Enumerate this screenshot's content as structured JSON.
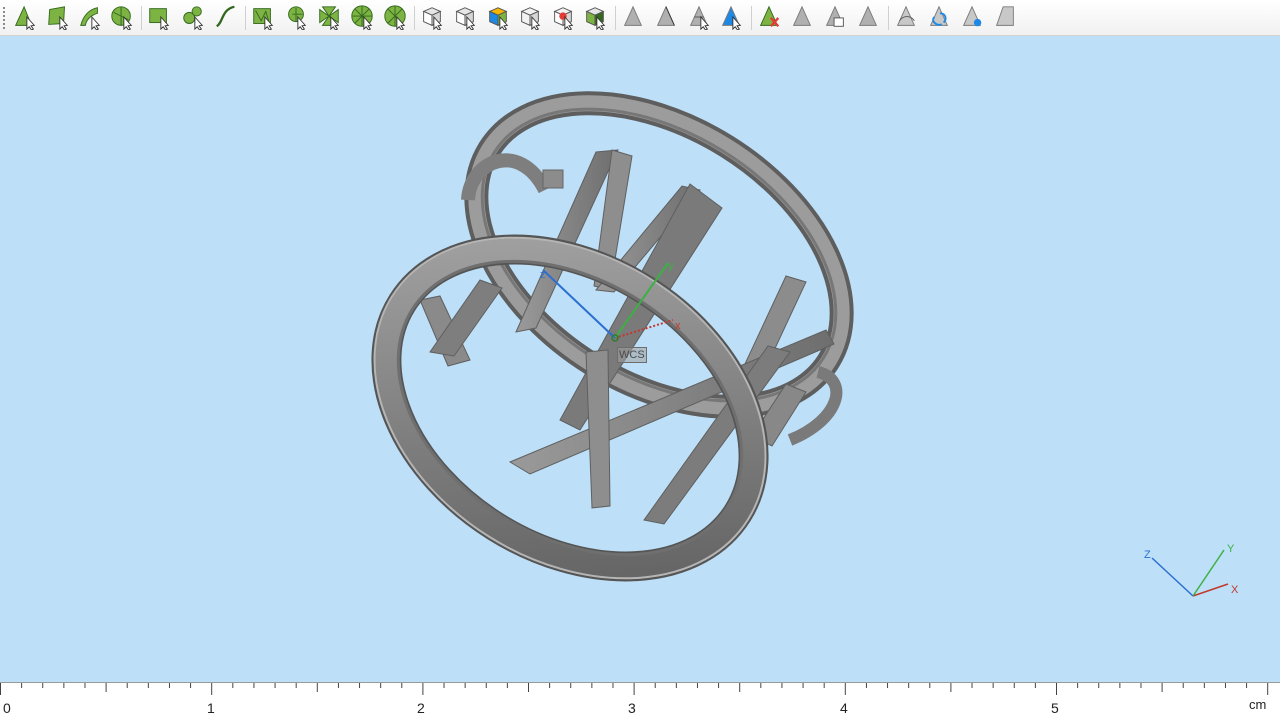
{
  "toolbar": {
    "buttons": [
      {
        "icon": "select-vertex-icon"
      },
      {
        "icon": "select-face-icon"
      },
      {
        "icon": "select-edge-icon"
      },
      {
        "icon": "select-surface-icon"
      },
      {
        "icon": "rectangle-select-icon"
      },
      {
        "icon": "lasso-select-icon"
      },
      {
        "icon": "curve-select-icon"
      },
      {
        "icon": "mesh-select-icon"
      },
      {
        "icon": "brush-select-icon"
      },
      {
        "icon": "cross-select-icon"
      },
      {
        "icon": "radial-select-icon"
      },
      {
        "icon": "radial-partial-select-icon"
      },
      {
        "icon": "select-body-icon"
      },
      {
        "icon": "select-solid-icon"
      },
      {
        "icon": "select-part-icon"
      },
      {
        "icon": "select-wire-body-icon"
      },
      {
        "icon": "select-component-icon"
      },
      {
        "icon": "select-assembly-icon"
      },
      {
        "icon": "show-icon"
      },
      {
        "icon": "show-edges-icon"
      },
      {
        "icon": "show-wireframe-icon"
      },
      {
        "icon": "show-selected-icon"
      },
      {
        "icon": "hide-icon"
      },
      {
        "icon": "hide-edges-icon"
      },
      {
        "icon": "hide-part-icon"
      },
      {
        "icon": "hide-faces-icon"
      },
      {
        "icon": "visibility-toggle-icon"
      },
      {
        "icon": "visibility-refresh-icon"
      },
      {
        "icon": "visibility-view-icon"
      },
      {
        "icon": "visibility-faces-icon"
      }
    ]
  },
  "viewport": {
    "background": "#bde0f8",
    "model_color": "#8a8a8a",
    "wcs": {
      "label": "WCS",
      "x_label": "x",
      "y_label": "y",
      "z_label": "z"
    }
  },
  "triad": {
    "x_label": "X",
    "y_label": "Y",
    "z_label": "Z"
  },
  "axis_colors": {
    "x": "#c0392b",
    "y": "#3cb043",
    "z": "#2c6fd1"
  },
  "ruler": {
    "ticks": [
      "0",
      "1",
      "2",
      "3",
      "4",
      "5"
    ],
    "unit": "cm"
  }
}
